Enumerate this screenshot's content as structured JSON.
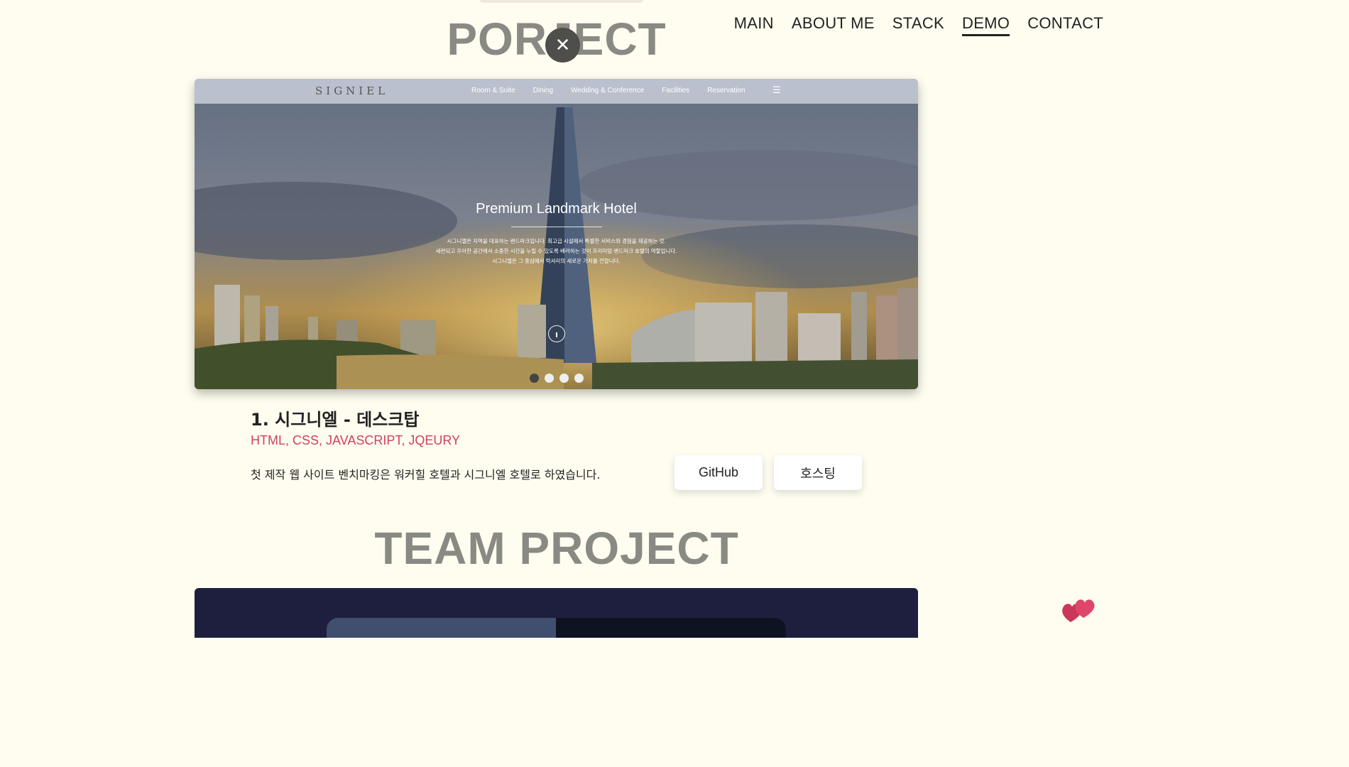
{
  "nav": {
    "items": [
      {
        "label": "MAIN"
      },
      {
        "label": "ABOUT ME"
      },
      {
        "label": "STACK"
      },
      {
        "label": "DEMO",
        "active": true
      },
      {
        "label": "CONTACT"
      }
    ]
  },
  "sections": {
    "project_title": "PORJECT",
    "team_title": "TEAM PROJECT"
  },
  "modal": {
    "close_glyph": "✕"
  },
  "preview": {
    "logo": "SIGNIEL",
    "menu": [
      "Room & Suite",
      "Dining",
      "Wedding & Conference",
      "Facilities",
      "Reservation"
    ],
    "hero_title": "Premium Landmark Hotel",
    "hero_lines": [
      "시그니엘은 지역을 대표하는 랜드마크입니다. 최고급 시설에서 특별한 서비스와 경험을 제공하는 것.",
      "세련되고 우아한 공간에서 소중한 시간을 누릴 수 있도록 배려하는 것이 프리미엄 랜드마크 호텔의 역할입니다.",
      "시그니엘은 그 중심에서 럭셔리의 새로운 가치를 전합니다."
    ],
    "slides": 4,
    "active_slide": 0
  },
  "project": {
    "title": "1. 시그니엘 - 데스크탑",
    "tech": "HTML, CSS, JAVASCRIPT, JQEURY",
    "desc": "첫 제작 웹 사이트 벤치마킹은 워커힐 호텔과 시그니엘 호텔로 하였습니다.",
    "github_label": "GitHub",
    "hosting_label": "호스팅"
  },
  "colors": {
    "background": "#fefdf0",
    "title_gray": "#8a8a84",
    "tech_red": "#d1415f",
    "team_navy": "#1e1f3e"
  }
}
